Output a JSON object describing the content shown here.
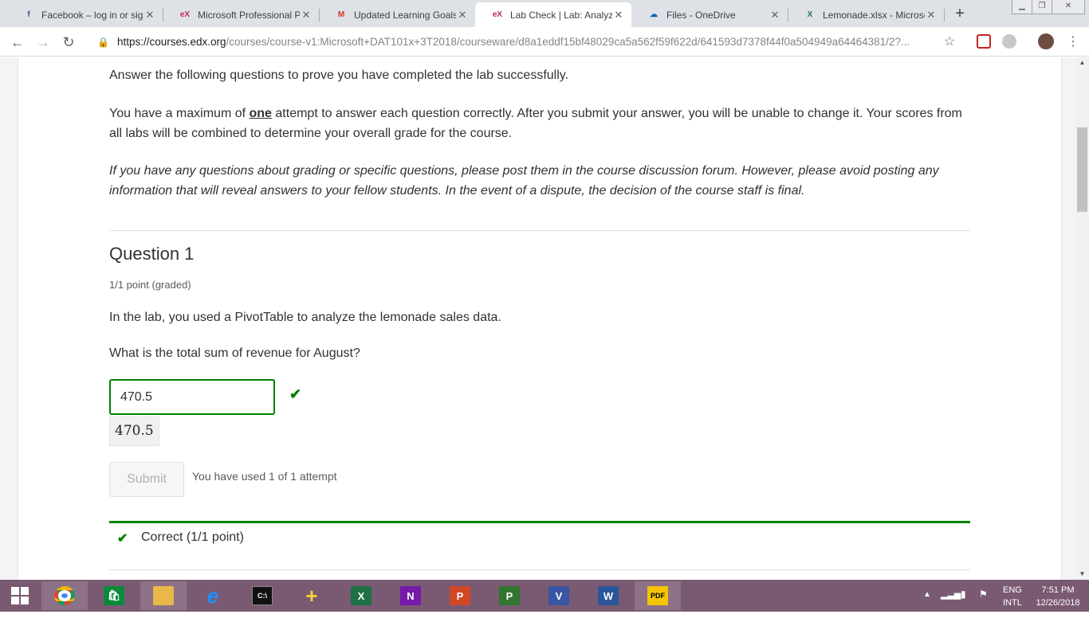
{
  "browser": {
    "tabs": [
      {
        "title": "Facebook – log in or sign",
        "icon": "facebook-icon",
        "color": "#3b5998",
        "glyph": "f"
      },
      {
        "title": "Microsoft Professional Pr",
        "icon": "edx-icon",
        "color": "#c4285b",
        "glyph": "eX"
      },
      {
        "title": "Updated Learning Goals",
        "icon": "gmail-icon",
        "color": "#d93025",
        "glyph": "M"
      },
      {
        "title": "Lab Check | Lab: Analyzin",
        "icon": "edx-icon",
        "color": "#c4285b",
        "glyph": "eX"
      },
      {
        "title": "Files - OneDrive",
        "icon": "onedrive-icon",
        "color": "#0a64c8",
        "glyph": "☁"
      },
      {
        "title": "Lemonade.xlsx - Microso",
        "icon": "excel-icon",
        "color": "#1e7145",
        "glyph": "X"
      }
    ],
    "active_tab": 3,
    "url_host": "https://courses.edx.org",
    "url_path": "/courses/course-v1:Microsoft+DAT101x+3T2018/courseware/d8a1eddf15bf48029ca5a562f59f622d/641593d7378f44f0a504949a64464381/2?..."
  },
  "page": {
    "intro": "Answer the following questions to prove you have completed the lab successfully.",
    "attempts_para_before": "You have a maximum of ",
    "attempts_para_bold": "one",
    "attempts_para_after": " attempt to answer each question correctly. After you submit your answer, you will be unable to change it. Your scores from all labs will be combined to determine your overall grade for the course.",
    "note": "If you have any questions about grading or specific questions, please post them in the course discussion forum. However, please avoid posting any information that will reveal answers to your fellow students. In the event of a dispute, the decision of the course staff is final.",
    "question": {
      "title": "Question 1",
      "points": "1/1 point (graded)",
      "prompt": "In the lab, you used a PivotTable to analyze the lemonade sales data.",
      "ask": "What is the total sum of revenue for August?",
      "answer_value": "470.5",
      "preview": "470.5",
      "submit_label": "Submit",
      "attempts": "You have used 1 of 1 attempt",
      "result": "Correct (1/1 point)"
    }
  },
  "taskbar": {
    "lang_line1": "ENG",
    "lang_line2": "INTL",
    "time": "7:51 PM",
    "date": "12/26/2018",
    "apps": [
      {
        "name": "chrome-icon",
        "glyph": "",
        "color": "#4285f4"
      },
      {
        "name": "store-icon",
        "glyph": "🛍",
        "color": "#0a8a3a"
      },
      {
        "name": "file-explorer-icon",
        "glyph": "",
        "color": "#e8b84a"
      },
      {
        "name": "internet-explorer-icon",
        "glyph": "e",
        "color": "#1e90ff"
      },
      {
        "name": "command-prompt-icon",
        "glyph": "C:\\",
        "color": "#111"
      },
      {
        "name": "health-app-icon",
        "glyph": "+",
        "color": "#f4d03f"
      },
      {
        "name": "excel-app-icon",
        "glyph": "X",
        "color": "#1e7145"
      },
      {
        "name": "onenote-app-icon",
        "glyph": "N",
        "color": "#7719aa"
      },
      {
        "name": "powerpoint-app-icon",
        "glyph": "P",
        "color": "#d24726"
      },
      {
        "name": "project-app-icon",
        "glyph": "P",
        "color": "#31752f"
      },
      {
        "name": "visio-app-icon",
        "glyph": "V",
        "color": "#3955a3"
      },
      {
        "name": "word-app-icon",
        "glyph": "W",
        "color": "#2b579a"
      },
      {
        "name": "pdf-app-icon",
        "glyph": "PDF",
        "color": "#f5c400"
      }
    ]
  }
}
